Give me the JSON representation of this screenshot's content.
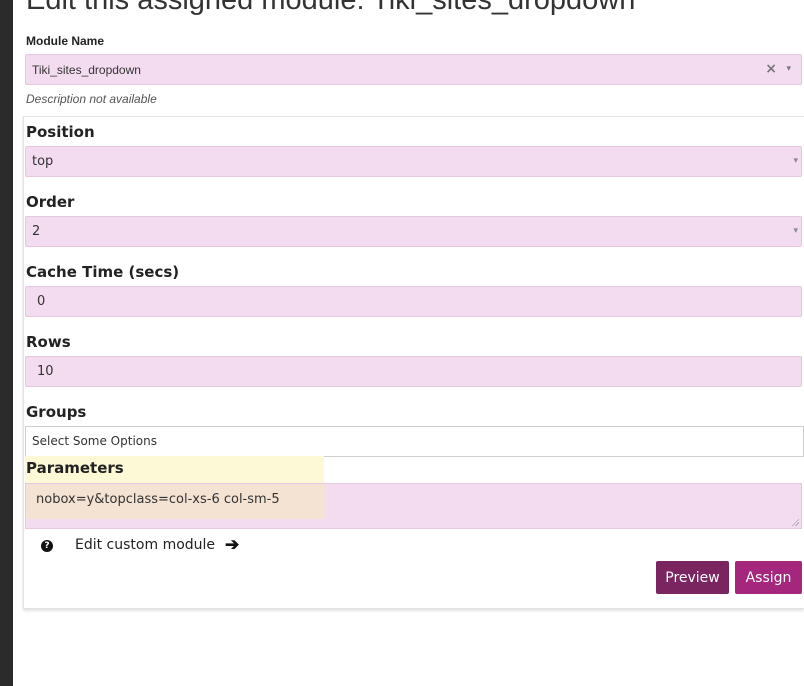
{
  "page": {
    "title": "Edit this assigned module: Tiki_sites_dropdown"
  },
  "module": {
    "label": "Module Name",
    "value": "Tiki_sites_dropdown",
    "clear_glyph": "×",
    "arrow_glyph": "▾",
    "description": "Description not available"
  },
  "fields": {
    "position": {
      "label": "Position",
      "value": "top",
      "arrow_glyph": "▾"
    },
    "order": {
      "label": "Order",
      "value": "2",
      "arrow_glyph": "▾"
    },
    "cache_time": {
      "label": "Cache Time (secs)",
      "value": "0"
    },
    "rows": {
      "label": "Rows",
      "value": "10"
    },
    "groups": {
      "label": "Groups",
      "placeholder": "Select Some Options"
    },
    "parameters": {
      "label": "Parameters",
      "value": "nobox=y&topclass=col-xs-6 col-sm-5"
    }
  },
  "help": {
    "icon": "question-circle-icon",
    "glyph": "?"
  },
  "custom_module": {
    "label": "Edit custom module",
    "arrow_glyph": "➔"
  },
  "buttons": {
    "preview": "Preview",
    "assign": "Assign"
  },
  "colors": {
    "field_bg": "#f4dcf0",
    "preview_button": "#7a2460",
    "assign_button": "#a4267d",
    "highlight": "#fdf8d6"
  }
}
